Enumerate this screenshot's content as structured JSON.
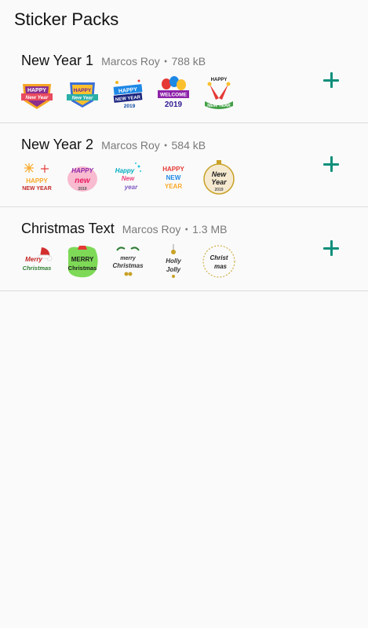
{
  "header": {
    "title": "Sticker Packs"
  },
  "packs": [
    {
      "name": "New Year 1",
      "author": "Marcos Roy",
      "size": "788 kB",
      "stickers": [
        {
          "icon": "happy-new-year-shield-icon",
          "l1": "HAPPY",
          "l2": "New Year"
        },
        {
          "icon": "happy-new-year-badge-icon",
          "l1": "HAPPY",
          "l2": "New Year"
        },
        {
          "icon": "happy-new-year-ribbon-icon",
          "l1": "HAPPY",
          "l2": "NEW YEAR",
          "l3": "2019"
        },
        {
          "icon": "welcome-2019-balloons-icon",
          "l1": "WELCOME",
          "l2": "2019"
        },
        {
          "icon": "happy-new-year-party-horns-icon",
          "l1": "HAPPY",
          "l2": "NEW YEAR"
        }
      ]
    },
    {
      "name": "New Year 2",
      "author": "Marcos Roy",
      "size": "584 kB",
      "stickers": [
        {
          "icon": "happy-new-year-fireworks-icon",
          "l1": "HAPPY",
          "l2": "NEW YEAR"
        },
        {
          "icon": "happy-new-year-pink-swirl-icon",
          "l1": "HAPPY",
          "l2": "new",
          "l3": "2019"
        },
        {
          "icon": "happy-new-year-script-icon",
          "l1": "Happy",
          "l2": "New",
          "l3": "year"
        },
        {
          "icon": "happy-new-year-stacked-icon",
          "l1": "HAPPY",
          "l2": "NEW",
          "l3": "YEAR"
        },
        {
          "icon": "new-year-ornament-icon",
          "l1": "New",
          "l2": "Year",
          "l3": "2019"
        }
      ]
    },
    {
      "name": "Christmas Text",
      "author": "Marcos Roy",
      "size": "1.3 MB",
      "stickers": [
        {
          "icon": "merry-christmas-santa-hat-icon",
          "l1": "Merry",
          "l2": "Christmas"
        },
        {
          "icon": "merry-christmas-green-blob-icon",
          "l1": "MERRY",
          "l2": "Christmas"
        },
        {
          "icon": "merry-christmas-wreath-icon",
          "l1": "merry",
          "l2": "Christmas"
        },
        {
          "icon": "holly-jolly-ornament-icon",
          "l1": "Holly",
          "l2": "Jolly"
        },
        {
          "icon": "christmas-circle-icon",
          "l1": "Christ",
          "l2": "mas"
        }
      ]
    }
  ]
}
